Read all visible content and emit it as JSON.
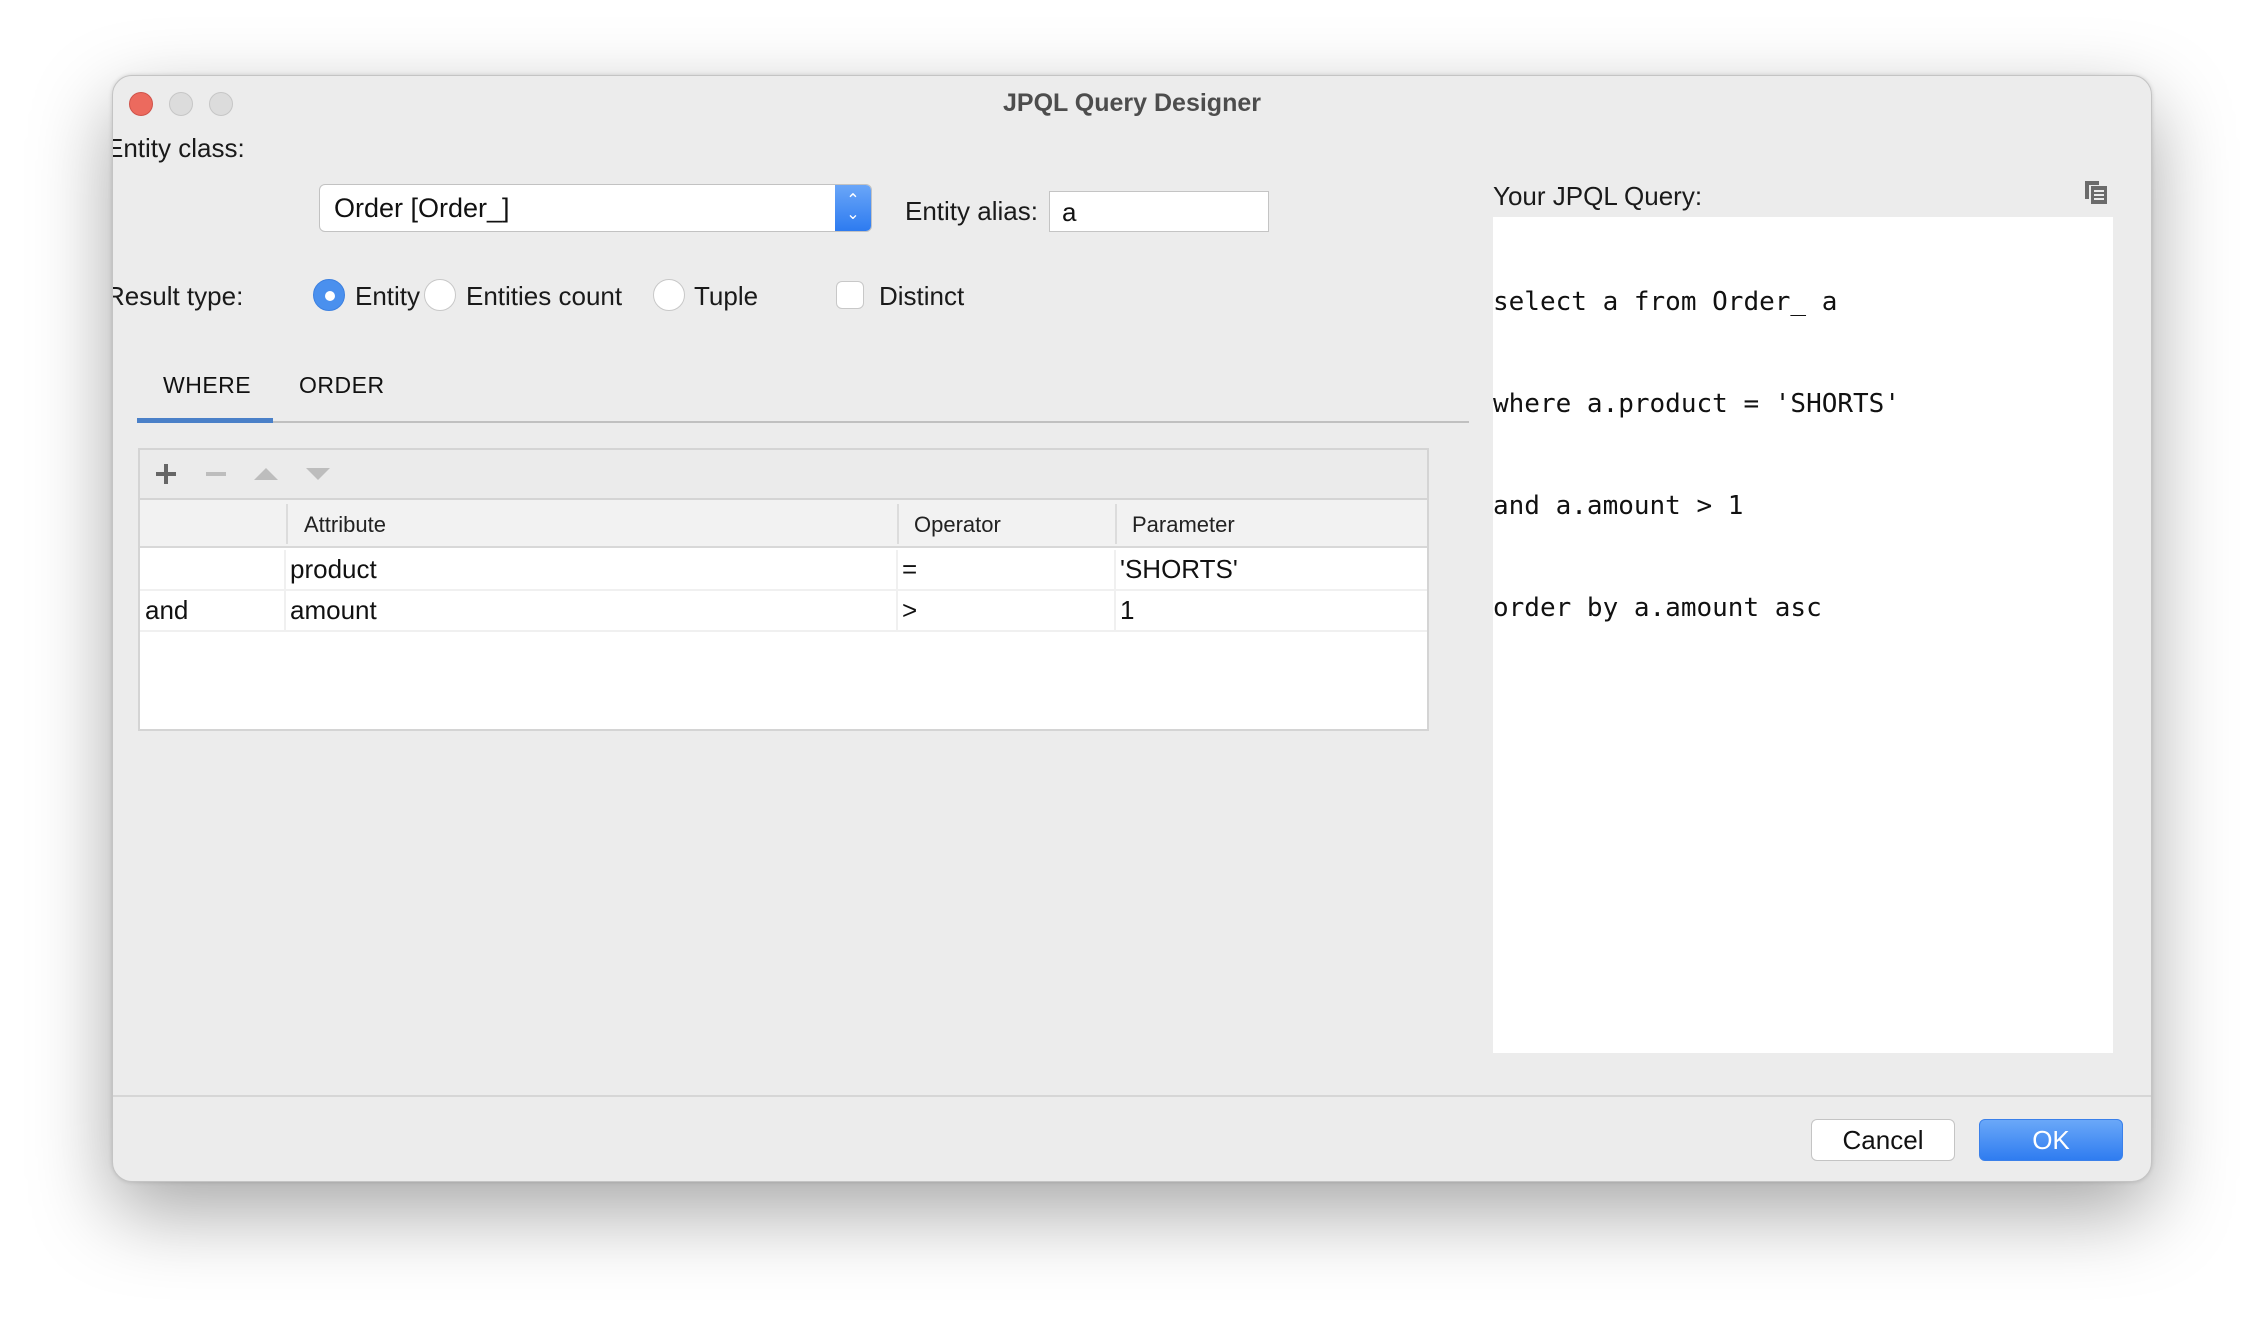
{
  "window": {
    "title": "JPQL Query Designer",
    "controls": [
      "close",
      "minimize",
      "maximize"
    ]
  },
  "form": {
    "entity_class_label": "Entity class:",
    "entity_class_value": "Order [Order_]",
    "entity_alias_label": "Entity alias:",
    "entity_alias_value": "a",
    "result_type_label": "Result type:",
    "result_types": [
      {
        "label": "Entity",
        "checked": true
      },
      {
        "label": "Entities count",
        "checked": false
      },
      {
        "label": "Tuple",
        "checked": false
      }
    ],
    "distinct_label": "Distinct",
    "distinct_checked": false
  },
  "tabs": [
    {
      "label": "WHERE",
      "active": true
    },
    {
      "label": "ORDER",
      "active": false
    }
  ],
  "conditions_table": {
    "toolbar": [
      {
        "icon": "plus-icon",
        "enabled": true
      },
      {
        "icon": "minus-icon",
        "enabled": false
      },
      {
        "icon": "move-up-icon",
        "enabled": false
      },
      {
        "icon": "move-down-icon",
        "enabled": false
      }
    ],
    "columns": [
      "",
      "Attribute",
      "Operator",
      "Parameter"
    ],
    "rows": [
      {
        "connector": "",
        "attribute": "product",
        "operator": "=",
        "parameter": "'SHORTS'"
      },
      {
        "connector": "and",
        "attribute": "amount",
        "operator": ">",
        "parameter": "1"
      }
    ]
  },
  "query_panel": {
    "label": "Your JPQL Query:",
    "copy_icon": "copy-icon",
    "lines": [
      "select a from Order_ a",
      "where a.product = 'SHORTS'",
      "and a.amount > 1",
      "order by a.amount asc"
    ]
  },
  "buttons": {
    "cancel": "Cancel",
    "ok": "OK"
  },
  "colors": {
    "accent": "#4a90ee",
    "tab_underline": "#4a80c8",
    "close_button": "#ec6a5e",
    "window_bg": "#ececec"
  }
}
